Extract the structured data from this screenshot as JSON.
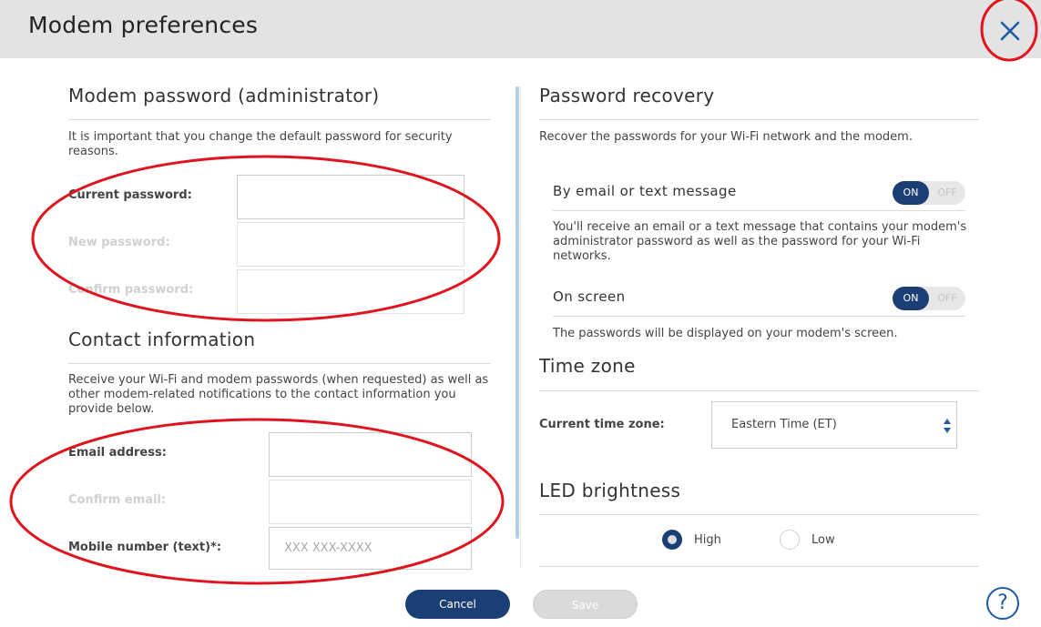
{
  "header": {
    "title": "Modem preferences"
  },
  "admin_password": {
    "title": "Modem password (administrator)",
    "description": "It is important that you change the default password for security reasons.",
    "current_label": "Current password:",
    "new_label": "New password:",
    "confirm_label": "Confirm password:"
  },
  "contact": {
    "title": "Contact information",
    "description": "Receive your Wi-Fi and modem passwords (when requested) as well as other modem-related notifications to the contact information you provide below.",
    "email_label": "Email address:",
    "confirm_email_label": "Confirm email:",
    "mobile_label": "Mobile number (text)*:",
    "mobile_placeholder": "XXX XXX-XXXX"
  },
  "recovery": {
    "title": "Password recovery",
    "description": "Recover the passwords for your Wi-Fi network and the modem.",
    "by_email": {
      "label": "By email or text message",
      "state": true,
      "on_text": "ON",
      "off_text": "OFF",
      "description": "You'll receive an email or a text message that contains your modem's administrator password as well as the password for your Wi-Fi networks."
    },
    "on_screen": {
      "label": "On screen",
      "state": true,
      "on_text": "ON",
      "off_text": "OFF",
      "description": "The passwords will be displayed on your modem's screen."
    }
  },
  "time_zone": {
    "title": "Time zone",
    "label": "Current time zone:",
    "value": "Eastern Time (ET)"
  },
  "led": {
    "title": "LED brightness",
    "options": [
      {
        "label": "High",
        "selected": true
      },
      {
        "label": "Low",
        "selected": false
      }
    ]
  },
  "footer": {
    "cancel_label": "Cancel",
    "save_label": "Save",
    "help_symbol": "?"
  },
  "colors": {
    "header_bg": "#e3e3e3",
    "primary": "#1b3f74",
    "close_icon": "#1f5aa8",
    "annotation": "#e0141e",
    "divider_accent": "#b8cde6"
  },
  "icons": {
    "close": "close-icon",
    "select_arrows": "select-arrows-icon",
    "help": "help-icon"
  }
}
